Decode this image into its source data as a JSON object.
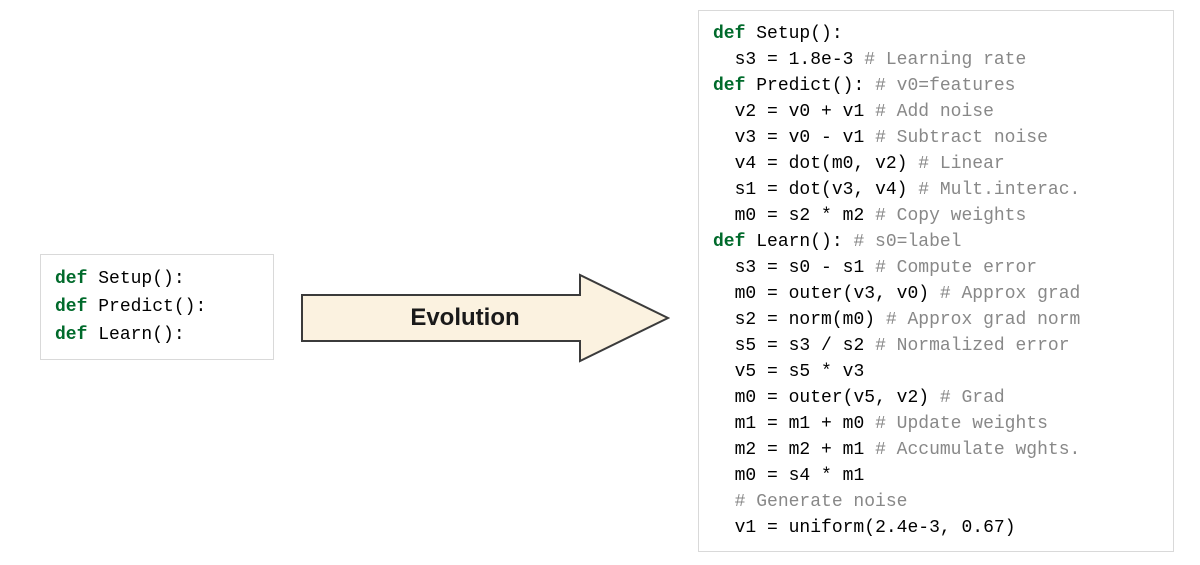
{
  "arrow": {
    "label": "Evolution",
    "fill": "#fbf2e0",
    "stroke": "#3b3b3b"
  },
  "left_box": {
    "lines": [
      [
        {
          "cls": "kw",
          "t": "def"
        },
        {
          "cls": "op",
          "t": " "
        },
        {
          "cls": "fn",
          "t": "Setup"
        },
        {
          "cls": "op",
          "t": "():"
        }
      ],
      [
        {
          "cls": "kw",
          "t": "def"
        },
        {
          "cls": "op",
          "t": " "
        },
        {
          "cls": "fn",
          "t": "Predict"
        },
        {
          "cls": "op",
          "t": "():"
        }
      ],
      [
        {
          "cls": "kw",
          "t": "def"
        },
        {
          "cls": "op",
          "t": " "
        },
        {
          "cls": "fn",
          "t": "Learn"
        },
        {
          "cls": "op",
          "t": "():"
        }
      ]
    ]
  },
  "right_box": {
    "lines": [
      [
        {
          "cls": "kw",
          "t": "def"
        },
        {
          "cls": "op",
          "t": " "
        },
        {
          "cls": "fn",
          "t": "Setup"
        },
        {
          "cls": "op",
          "t": "():"
        }
      ],
      [
        {
          "cls": "op",
          "t": "  "
        },
        {
          "cls": "id",
          "t": "s3"
        },
        {
          "cls": "op",
          "t": " = "
        },
        {
          "cls": "num",
          "t": "1.8e-3"
        },
        {
          "cls": "op",
          "t": " "
        },
        {
          "cls": "cm",
          "t": "# Learning rate"
        }
      ],
      [
        {
          "cls": "kw",
          "t": "def"
        },
        {
          "cls": "op",
          "t": " "
        },
        {
          "cls": "fn",
          "t": "Predict"
        },
        {
          "cls": "op",
          "t": "():"
        },
        {
          "cls": "op",
          "t": " "
        },
        {
          "cls": "cm",
          "t": "# v0=features"
        }
      ],
      [
        {
          "cls": "op",
          "t": "  "
        },
        {
          "cls": "id",
          "t": "v2"
        },
        {
          "cls": "op",
          "t": " = "
        },
        {
          "cls": "id",
          "t": "v0"
        },
        {
          "cls": "op",
          "t": " + "
        },
        {
          "cls": "id",
          "t": "v1"
        },
        {
          "cls": "op",
          "t": " "
        },
        {
          "cls": "cm",
          "t": "# Add noise"
        }
      ],
      [
        {
          "cls": "op",
          "t": "  "
        },
        {
          "cls": "id",
          "t": "v3"
        },
        {
          "cls": "op",
          "t": " = "
        },
        {
          "cls": "id",
          "t": "v0"
        },
        {
          "cls": "op",
          "t": " - "
        },
        {
          "cls": "id",
          "t": "v1"
        },
        {
          "cls": "op",
          "t": " "
        },
        {
          "cls": "cm",
          "t": "# Subtract noise"
        }
      ],
      [
        {
          "cls": "op",
          "t": "  "
        },
        {
          "cls": "id",
          "t": "v4"
        },
        {
          "cls": "op",
          "t": " = "
        },
        {
          "cls": "id",
          "t": "dot"
        },
        {
          "cls": "op",
          "t": "("
        },
        {
          "cls": "id",
          "t": "m0"
        },
        {
          "cls": "op",
          "t": ", "
        },
        {
          "cls": "id",
          "t": "v2"
        },
        {
          "cls": "op",
          "t": ") "
        },
        {
          "cls": "cm",
          "t": "# Linear"
        }
      ],
      [
        {
          "cls": "op",
          "t": "  "
        },
        {
          "cls": "id",
          "t": "s1"
        },
        {
          "cls": "op",
          "t": " = "
        },
        {
          "cls": "id",
          "t": "dot"
        },
        {
          "cls": "op",
          "t": "("
        },
        {
          "cls": "id",
          "t": "v3"
        },
        {
          "cls": "op",
          "t": ", "
        },
        {
          "cls": "id",
          "t": "v4"
        },
        {
          "cls": "op",
          "t": ") "
        },
        {
          "cls": "cm",
          "t": "# Mult.interac."
        }
      ],
      [
        {
          "cls": "op",
          "t": "  "
        },
        {
          "cls": "id",
          "t": "m0"
        },
        {
          "cls": "op",
          "t": " = "
        },
        {
          "cls": "id",
          "t": "s2"
        },
        {
          "cls": "op",
          "t": " * "
        },
        {
          "cls": "id",
          "t": "m2"
        },
        {
          "cls": "op",
          "t": " "
        },
        {
          "cls": "cm",
          "t": "# Copy weights"
        }
      ],
      [
        {
          "cls": "kw",
          "t": "def"
        },
        {
          "cls": "op",
          "t": " "
        },
        {
          "cls": "fn",
          "t": "Learn"
        },
        {
          "cls": "op",
          "t": "():"
        },
        {
          "cls": "op",
          "t": " "
        },
        {
          "cls": "cm",
          "t": "# s0=label"
        }
      ],
      [
        {
          "cls": "op",
          "t": "  "
        },
        {
          "cls": "id",
          "t": "s3"
        },
        {
          "cls": "op",
          "t": " = "
        },
        {
          "cls": "id",
          "t": "s0"
        },
        {
          "cls": "op",
          "t": " - "
        },
        {
          "cls": "id",
          "t": "s1"
        },
        {
          "cls": "op",
          "t": " "
        },
        {
          "cls": "cm",
          "t": "# Compute error"
        }
      ],
      [
        {
          "cls": "op",
          "t": "  "
        },
        {
          "cls": "id",
          "t": "m0"
        },
        {
          "cls": "op",
          "t": " = "
        },
        {
          "cls": "id",
          "t": "outer"
        },
        {
          "cls": "op",
          "t": "("
        },
        {
          "cls": "id",
          "t": "v3"
        },
        {
          "cls": "op",
          "t": ", "
        },
        {
          "cls": "id",
          "t": "v0"
        },
        {
          "cls": "op",
          "t": ") "
        },
        {
          "cls": "cm",
          "t": "# Approx grad"
        }
      ],
      [
        {
          "cls": "op",
          "t": "  "
        },
        {
          "cls": "id",
          "t": "s2"
        },
        {
          "cls": "op",
          "t": " = "
        },
        {
          "cls": "id",
          "t": "norm"
        },
        {
          "cls": "op",
          "t": "("
        },
        {
          "cls": "id",
          "t": "m0"
        },
        {
          "cls": "op",
          "t": ") "
        },
        {
          "cls": "cm",
          "t": "# Approx grad norm"
        }
      ],
      [
        {
          "cls": "op",
          "t": "  "
        },
        {
          "cls": "id",
          "t": "s5"
        },
        {
          "cls": "op",
          "t": " = "
        },
        {
          "cls": "id",
          "t": "s3"
        },
        {
          "cls": "op",
          "t": " / "
        },
        {
          "cls": "id",
          "t": "s2"
        },
        {
          "cls": "op",
          "t": " "
        },
        {
          "cls": "cm",
          "t": "# Normalized error"
        }
      ],
      [
        {
          "cls": "op",
          "t": "  "
        },
        {
          "cls": "id",
          "t": "v5"
        },
        {
          "cls": "op",
          "t": " = "
        },
        {
          "cls": "id",
          "t": "s5"
        },
        {
          "cls": "op",
          "t": " * "
        },
        {
          "cls": "id",
          "t": "v3"
        }
      ],
      [
        {
          "cls": "op",
          "t": "  "
        },
        {
          "cls": "id",
          "t": "m0"
        },
        {
          "cls": "op",
          "t": " = "
        },
        {
          "cls": "id",
          "t": "outer"
        },
        {
          "cls": "op",
          "t": "("
        },
        {
          "cls": "id",
          "t": "v5"
        },
        {
          "cls": "op",
          "t": ", "
        },
        {
          "cls": "id",
          "t": "v2"
        },
        {
          "cls": "op",
          "t": ") "
        },
        {
          "cls": "cm",
          "t": "# Grad"
        }
      ],
      [
        {
          "cls": "op",
          "t": "  "
        },
        {
          "cls": "id",
          "t": "m1"
        },
        {
          "cls": "op",
          "t": " = "
        },
        {
          "cls": "id",
          "t": "m1"
        },
        {
          "cls": "op",
          "t": " + "
        },
        {
          "cls": "id",
          "t": "m0"
        },
        {
          "cls": "op",
          "t": " "
        },
        {
          "cls": "cm",
          "t": "# Update weights"
        }
      ],
      [
        {
          "cls": "op",
          "t": "  "
        },
        {
          "cls": "id",
          "t": "m2"
        },
        {
          "cls": "op",
          "t": " = "
        },
        {
          "cls": "id",
          "t": "m2"
        },
        {
          "cls": "op",
          "t": " + "
        },
        {
          "cls": "id",
          "t": "m1"
        },
        {
          "cls": "op",
          "t": " "
        },
        {
          "cls": "cm",
          "t": "# Accumulate wghts."
        }
      ],
      [
        {
          "cls": "op",
          "t": "  "
        },
        {
          "cls": "id",
          "t": "m0"
        },
        {
          "cls": "op",
          "t": " = "
        },
        {
          "cls": "id",
          "t": "s4"
        },
        {
          "cls": "op",
          "t": " * "
        },
        {
          "cls": "id",
          "t": "m1"
        }
      ],
      [
        {
          "cls": "op",
          "t": "  "
        },
        {
          "cls": "cm",
          "t": "# Generate noise"
        }
      ],
      [
        {
          "cls": "op",
          "t": "  "
        },
        {
          "cls": "id",
          "t": "v1"
        },
        {
          "cls": "op",
          "t": " = "
        },
        {
          "cls": "id",
          "t": "uniform"
        },
        {
          "cls": "op",
          "t": "("
        },
        {
          "cls": "num",
          "t": "2.4e-3"
        },
        {
          "cls": "op",
          "t": ", "
        },
        {
          "cls": "num",
          "t": "0.67"
        },
        {
          "cls": "op",
          "t": ")"
        }
      ]
    ]
  }
}
